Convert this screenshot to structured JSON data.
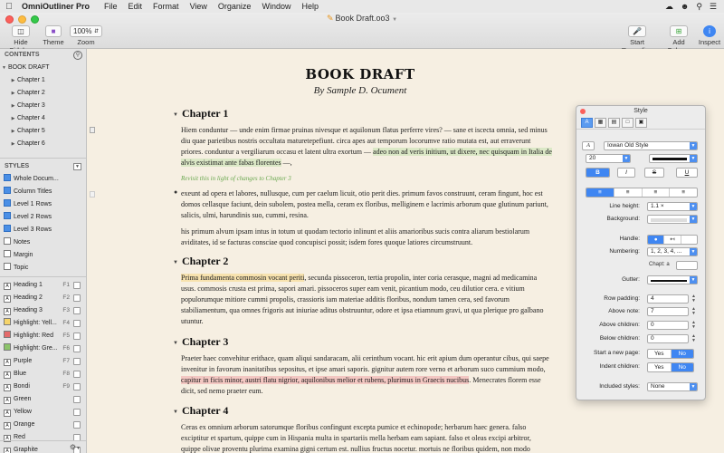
{
  "menubar": {
    "app_name": "OmniOutliner Pro",
    "items": [
      "File",
      "Edit",
      "Format",
      "View",
      "Organize",
      "Window",
      "Help"
    ]
  },
  "window": {
    "title": "Book Draft.oo3",
    "toolbar": {
      "hide_sidebar": "Hide Sidebar",
      "theme": "Theme",
      "zoom_label": "Zoom",
      "zoom_value": "100%",
      "start_recording": "Start Recording",
      "add_column": "Add Column",
      "inspect": "Inspect"
    }
  },
  "sidebar": {
    "contents_header": "CONTENTS",
    "root": "BOOK DRAFT",
    "chapters": [
      "Chapter 1",
      "Chapter 2",
      "Chapter 3",
      "Chapter 4",
      "Chapter 5",
      "Chapter 6"
    ],
    "styles_header": "STYLES",
    "styles": [
      "Whole Docum...",
      "Column Titles",
      "Level 1 Rows",
      "Level 2 Rows",
      "Level 3 Rows",
      "Notes",
      "Margin",
      "Topic"
    ],
    "named_styles": [
      {
        "label": "Heading 1",
        "key": "F1",
        "color": "#ffffff",
        "glyph": "A"
      },
      {
        "label": "Heading 2",
        "key": "F2",
        "color": "#ffffff",
        "glyph": "A"
      },
      {
        "label": "Heading 3",
        "key": "F3",
        "color": "#ffffff",
        "glyph": "A"
      },
      {
        "label": "Highlight: Yell...",
        "key": "F4",
        "color": "#f5d46a",
        "glyph": ""
      },
      {
        "label": "Highlight: Red",
        "key": "F5",
        "color": "#e36a6a",
        "glyph": ""
      },
      {
        "label": "Highlight: Gre...",
        "key": "F6",
        "color": "#8cc46a",
        "glyph": ""
      },
      {
        "label": "Purple",
        "key": "F7",
        "color": "#ffffff",
        "glyph": "A"
      },
      {
        "label": "Blue",
        "key": "F8",
        "color": "#ffffff",
        "glyph": "A"
      },
      {
        "label": "Bondi",
        "key": "F9",
        "color": "#ffffff",
        "glyph": "A"
      },
      {
        "label": "Green",
        "key": "",
        "color": "#ffffff",
        "glyph": "A"
      },
      {
        "label": "Yellow",
        "key": "",
        "color": "#ffffff",
        "glyph": "A"
      },
      {
        "label": "Orange",
        "key": "",
        "color": "#ffffff",
        "glyph": "A"
      },
      {
        "label": "Red",
        "key": "",
        "color": "#ffffff",
        "glyph": "A"
      },
      {
        "label": "Graphite",
        "key": "",
        "color": "#ffffff",
        "glyph": "A"
      }
    ]
  },
  "document": {
    "title": "BOOK DRAFT",
    "subtitle": "By Sample D. Ocument",
    "ch1": {
      "heading": "Chapter 1",
      "p1a": "Hiem conduntur — unde enim firmae pruinas nivesque et aquilonum flatus perferre vires? — sane et iscecta omnia, sed minus diu quae parietibus nostris occultata maturetepefiunt. circa apes aut temporum locorumve ratio mutata est, aut ",
      "p1b": "erraverunt priores. conduntur a vergiliarum occasu et latent ultra exortum — ",
      "p1hl": "adeo non ad veris initium, ut dixere, nec quisquam in Italia de alvis existimat ante fabas florentes",
      "p1c": " —,",
      "note": "Revisit this in light of changes to Chapter 3",
      "p2": "exeunt ad opera et labores, nullusque, cum per caelum licuit, otio perit dies. primum favos construunt, ceram fingunt, hoc est domos cellasque faciunt, dein subolem, postea mella, ceram ex floribus, melliginem e lacrimis arborum quae glutinum pariunt, salicis, ulmi, harundinis suo, cummi, resina.",
      "p3": "his primum alvum ipsam intus in totum ut quodam tectorio inlinunt et aliis amarioribus sucis contra aliarum bestiolarum aviditates, id se facturas consciae quod concupisci possit; isdem fores quoque latiores circumstruunt."
    },
    "ch2": {
      "heading": "Chapter 2",
      "p1hl": "Prima fundamenta commosin vocant periti",
      "p1": ", secunda pissoceron, tertia propolin, inter coria cerasque, magni ad medicamina usus. commosis crusta est prima, sapori amari. pissoceros super eam venit, picantium modo, ceu dilutior cera. e vitium populorumque mitiore cummi propolis, crassioris iam materiae additis floribus, nondum tamen cera, sed favorum stabiliamentum, qua omnes frigoris aut iniuriae aditus obstruuntur, odore et ipsa etiamnum gravi, ut qua plerique pro galbano utuntur."
    },
    "ch3": {
      "heading": "Chapter 3",
      "p1a": "Praeter haec convehitur erithace, quam aliqui sandaracam, alii cerinthum vocant. hic erit apium dum operantur cibus, qui saepe invenitur in favorum inanitatibus sepositus, et ipse amari saporis. gignitur autem rore verno et arborum suco cummium modo, ",
      "p1hl": "capitur in ficis minor, austri flatu nigrior, aquilonibus melior et rubens, plurimus in Graecis nucibus",
      "p1b": ". Menecrates florem esse dicit, sed nemo praeter eum."
    },
    "ch4": {
      "heading": "Chapter 4",
      "p1": "Ceras ex omnium arborum satorumque floribus confingunt excepta pumice et echinopode; herbarum haec genera. falso exciptitur et spartum, quippe cum in Hispania multa in spartariis mella herbam eam sapiant. falso et oleas excipi arbitror, quippe olivae proventu plurima examina gigni certum est. nullius fructus nocetur. mortuis ne floribus quidem, non modo corporibus, insidunt."
    }
  },
  "inspector": {
    "title": "Style",
    "font_sample": "A",
    "font_family": "Iowan Old Style",
    "font_size": "20",
    "line_height_label": "Line height:",
    "line_height": "1.1 ×",
    "background_label": "Background:",
    "handle_label": "Handle:",
    "numbering_label": "Numbering:",
    "numbering": "1, 2, 3, 4, ...",
    "chapter_prefix": "Chapt: a",
    "gutter_label": "Gutter:",
    "row_padding_label": "Row padding:",
    "row_padding": "4",
    "above_note_label": "Above note:",
    "above_note": "7",
    "above_children_label": "Above children:",
    "above_children": "0",
    "below_children_label": "Below children:",
    "below_children": "0",
    "new_page_label": "Start a new page:",
    "indent_children_label": "Indent children:",
    "yes": "Yes",
    "no": "No",
    "included_styles_label": "Included styles:",
    "included_styles": "None"
  }
}
